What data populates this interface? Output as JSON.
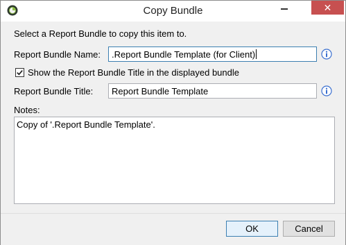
{
  "window": {
    "title": "Copy Bundle",
    "close_glyph": "✕"
  },
  "dialog": {
    "intro": "Select a Report Bundle to copy this item to.",
    "bundle_name_label": "Report Bundle Name:",
    "bundle_name_value": ".Report Bundle Template (for Client)",
    "show_title_label": "Show the Report Bundle Title in the displayed bundle",
    "show_title_checked": true,
    "bundle_title_label": "Report Bundle Title:",
    "bundle_title_value": "Report Bundle Template",
    "notes_label": "Notes:",
    "notes_value": "Copy of '.Report Bundle Template'."
  },
  "buttons": {
    "ok": "OK",
    "cancel": "Cancel"
  },
  "colors": {
    "close_button": "#c75050",
    "info_icon": "#3a6fd0",
    "focus_border": "#3c7fb1"
  },
  "icons": {
    "app": "app-logo-icon",
    "info": "info-icon",
    "check": "checkmark-icon"
  }
}
